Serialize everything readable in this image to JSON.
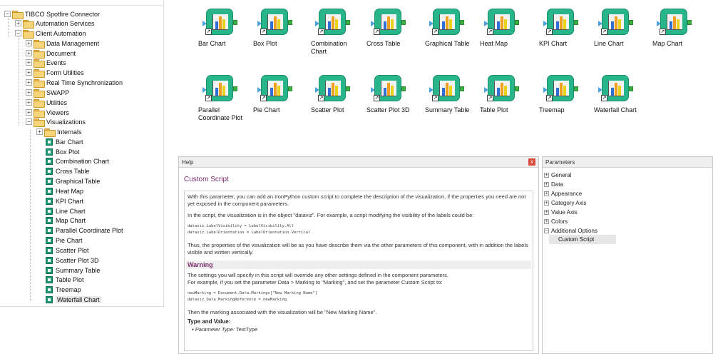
{
  "tree": {
    "items": [
      {
        "label": "TIBCO Spotfire Connector",
        "expander": "⊖",
        "icon": "folder-icon"
      },
      {
        "label": "Automation Services",
        "expander": "⊕",
        "icon": "folder-icon"
      },
      {
        "label": "Client Automation",
        "expander": "⊖",
        "icon": "folder-icon"
      },
      {
        "label": "Data Management",
        "expander": "⊕",
        "icon": "folder-icon"
      },
      {
        "label": "Document",
        "expander": "⊕",
        "icon": "folder-icon"
      },
      {
        "label": "Events",
        "expander": "⊕",
        "icon": "folder-icon"
      },
      {
        "label": "Form Utilities",
        "expander": "⊕",
        "icon": "folder-icon"
      },
      {
        "label": "Real Time Synchronization",
        "expander": "⊕",
        "icon": "folder-icon"
      },
      {
        "label": "SWAPP",
        "expander": "⊕",
        "icon": "folder-icon"
      },
      {
        "label": "Utilities",
        "expander": "⊕",
        "icon": "folder-icon"
      },
      {
        "label": "Viewers",
        "expander": "⊕",
        "icon": "folder-icon"
      },
      {
        "label": "Visualizations",
        "expander": "⊖",
        "icon": "folder-icon"
      },
      {
        "label": "Internals",
        "expander": "⊕",
        "icon": "folder-icon"
      },
      {
        "label": "Bar Chart",
        "icon": "node-icon"
      },
      {
        "label": "Box Plot",
        "icon": "node-icon"
      },
      {
        "label": "Combination Chart",
        "icon": "node-icon"
      },
      {
        "label": "Cross Table",
        "icon": "node-icon"
      },
      {
        "label": "Graphical Table",
        "icon": "node-icon"
      },
      {
        "label": "Heat Map",
        "icon": "node-icon"
      },
      {
        "label": "KPI Chart",
        "icon": "node-icon"
      },
      {
        "label": "Line Chart",
        "icon": "node-icon"
      },
      {
        "label": "Map Chart",
        "icon": "node-icon"
      },
      {
        "label": "Parallel Coordinate Plot",
        "icon": "node-icon"
      },
      {
        "label": "Pie Chart",
        "icon": "node-icon"
      },
      {
        "label": "Scatter Plot",
        "icon": "node-icon"
      },
      {
        "label": "Scatter Plot 3D",
        "icon": "node-icon"
      },
      {
        "label": "Summary Table",
        "icon": "node-icon"
      },
      {
        "label": "Table Plot",
        "icon": "node-icon"
      },
      {
        "label": "Treemap",
        "icon": "node-icon"
      },
      {
        "label": "Waterfall Chart",
        "icon": "node-icon",
        "selected": true
      }
    ]
  },
  "palette": {
    "shortcut_glyph": "↗",
    "row1": [
      {
        "label": "Bar Chart"
      },
      {
        "label": "Box Plot"
      },
      {
        "label": "Combination Chart"
      },
      {
        "label": "Cross Table"
      },
      {
        "label": "Graphical Table"
      },
      {
        "label": "Heat Map"
      },
      {
        "label": "KPI Chart"
      },
      {
        "label": "Line Chart"
      },
      {
        "label": "Map Chart"
      }
    ],
    "row2": [
      {
        "label": "Parallel Coordinate Plot"
      },
      {
        "label": "Pie Chart"
      },
      {
        "label": "Scatter Plot"
      },
      {
        "label": "Scatter Plot 3D"
      },
      {
        "label": "Summary Table"
      },
      {
        "label": "Table Plot"
      },
      {
        "label": "Treemap"
      },
      {
        "label": "Waterfall Chart"
      }
    ],
    "colors": {
      "tile": "#27b589",
      "bar_blue": "#2f6fd6",
      "bar_orange": "#f0a020",
      "bar_yellow": "#e8d21a",
      "port_in": "#4aa3e0",
      "port_out": "#3cb043"
    }
  },
  "help": {
    "header": "Help",
    "close_label": "x",
    "title": "Custom Script",
    "intro": "With this parameter, you can add an IronPython custom script to complete the description of the visualization, if the properties you need are not yet exposed in the component parameters.",
    "script_note": "In the script, the visualization is in the object \"dataviz\". For example, a script modifying the visibility of the labels could be:",
    "code1_line1": "dataviz.LabelVisibility = LabelVisibility.All",
    "code1_line2": "dataviz.LabelOrientation = LabelOrientation.Vertical",
    "after_code1": "Thus, the properties of the visualization will be as you have describe them via the other parameters of this component, with in addition the labels visible and written vertically.",
    "warning_title": "Warning",
    "warning_text_1": "The settings you will specify in this script will override any other settings defined in the component parameters.",
    "warning_text_2": "For example, if you set the parameter Data > Marking to \"Marking\", and set the parameter Custom Script to:",
    "code2_line1": "newMarking = Document.Data.Markings[\"New Marking Name\"]",
    "code2_line2": "dataviz.Data.MarkingReference = newMarking",
    "after_code2": "Then the marking associated with the visualization will be \"New Marking Name\".",
    "type_title": "Type and Value:",
    "param_type_label": "Parameter Type:",
    "param_type_value": "TextType"
  },
  "parameters": {
    "header": "Parameters",
    "items": [
      {
        "label": "General",
        "expander": "+"
      },
      {
        "label": "Data",
        "expander": "+"
      },
      {
        "label": "Appearance",
        "expander": "+"
      },
      {
        "label": "Category Axis",
        "expander": "+"
      },
      {
        "label": "Value Axis",
        "expander": "+"
      },
      {
        "label": "Colors",
        "expander": "+"
      },
      {
        "label": "Additional Options",
        "expander": "−"
      }
    ],
    "selected_child": "Custom Script"
  }
}
